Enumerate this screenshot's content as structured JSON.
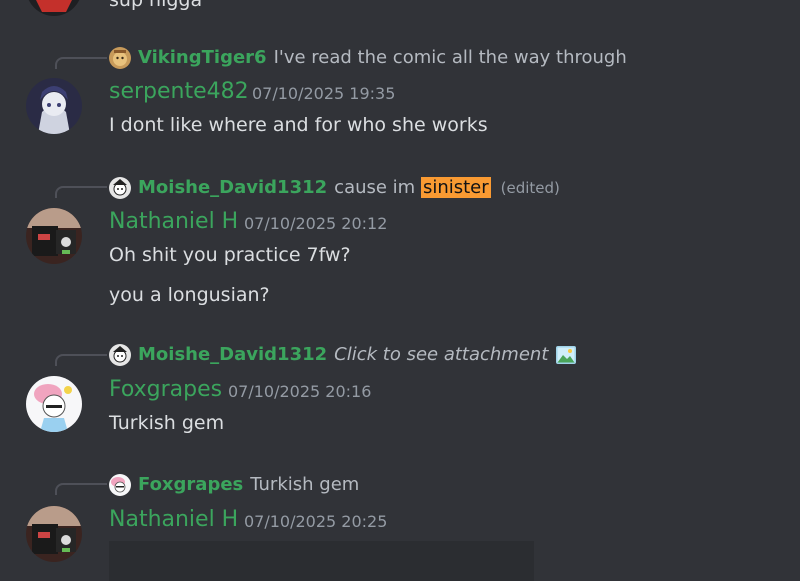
{
  "messages": [
    {
      "partial_text": "sup nigga"
    },
    {
      "reply": {
        "name": "VikingTiger6",
        "text": "I've read the comic all the way through"
      },
      "author": "serpente482",
      "timestamp": "07/10/2025 19:35",
      "lines": [
        "I dont like where and for who she works"
      ]
    },
    {
      "reply": {
        "name": "Moishe_David1312",
        "text_before": "cause im ",
        "highlight": "sinister",
        "edited": "(edited)"
      },
      "author": "Nathaniel H",
      "timestamp": "07/10/2025 20:12",
      "lines": [
        "Oh shit you practice 7fw?",
        "you a longusian?"
      ]
    },
    {
      "reply": {
        "name": "Moishe_David1312",
        "text": "Click to see attachment"
      },
      "author": "Foxgrapes",
      "timestamp": "07/10/2025 20:16",
      "lines": [
        "Turkish gem"
      ]
    },
    {
      "reply": {
        "name": "Foxgrapes",
        "text": "Turkish gem"
      },
      "author": "Nathaniel H",
      "timestamp": "07/10/2025 20:25",
      "lines": []
    }
  ],
  "icons": {
    "image_attachment": "image-icon"
  },
  "colors": {
    "background": "#313338",
    "username": "#3ba55d",
    "message_text": "#dbdee1",
    "muted": "#949ba4",
    "highlight": "#f99a32"
  }
}
